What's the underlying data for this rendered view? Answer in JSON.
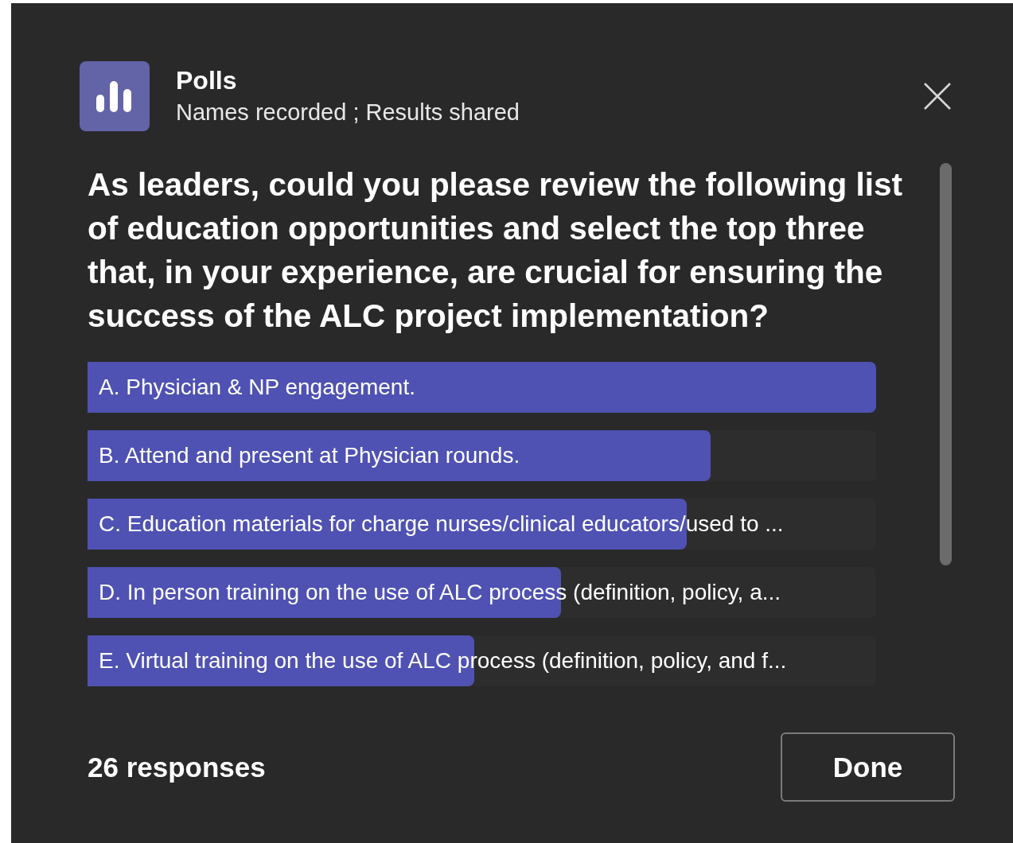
{
  "header": {
    "title": "Polls",
    "subtitle": "Names recorded ; Results shared"
  },
  "question": "As leaders, could you please review the following list of education opportunities and select the top three that, in your experience, are crucial for ensuring the success of the ALC project implementation?",
  "options": [
    {
      "label": "A. Physician & NP engagement.",
      "level": 1.0
    },
    {
      "label": "B. Attend and present at Physician rounds.",
      "level": 0.79
    },
    {
      "label": "C. Education materials for charge nurses/clinical educators/used to ...",
      "level": 0.76
    },
    {
      "label": "D. In person training on the use of ALC process (definition, policy, a...",
      "level": 0.6
    },
    {
      "label": "E. Virtual training on the use of ALC process (definition, policy, and f...",
      "level": 0.49
    }
  ],
  "footer": {
    "responses": "26 responses",
    "button": "Done"
  }
}
